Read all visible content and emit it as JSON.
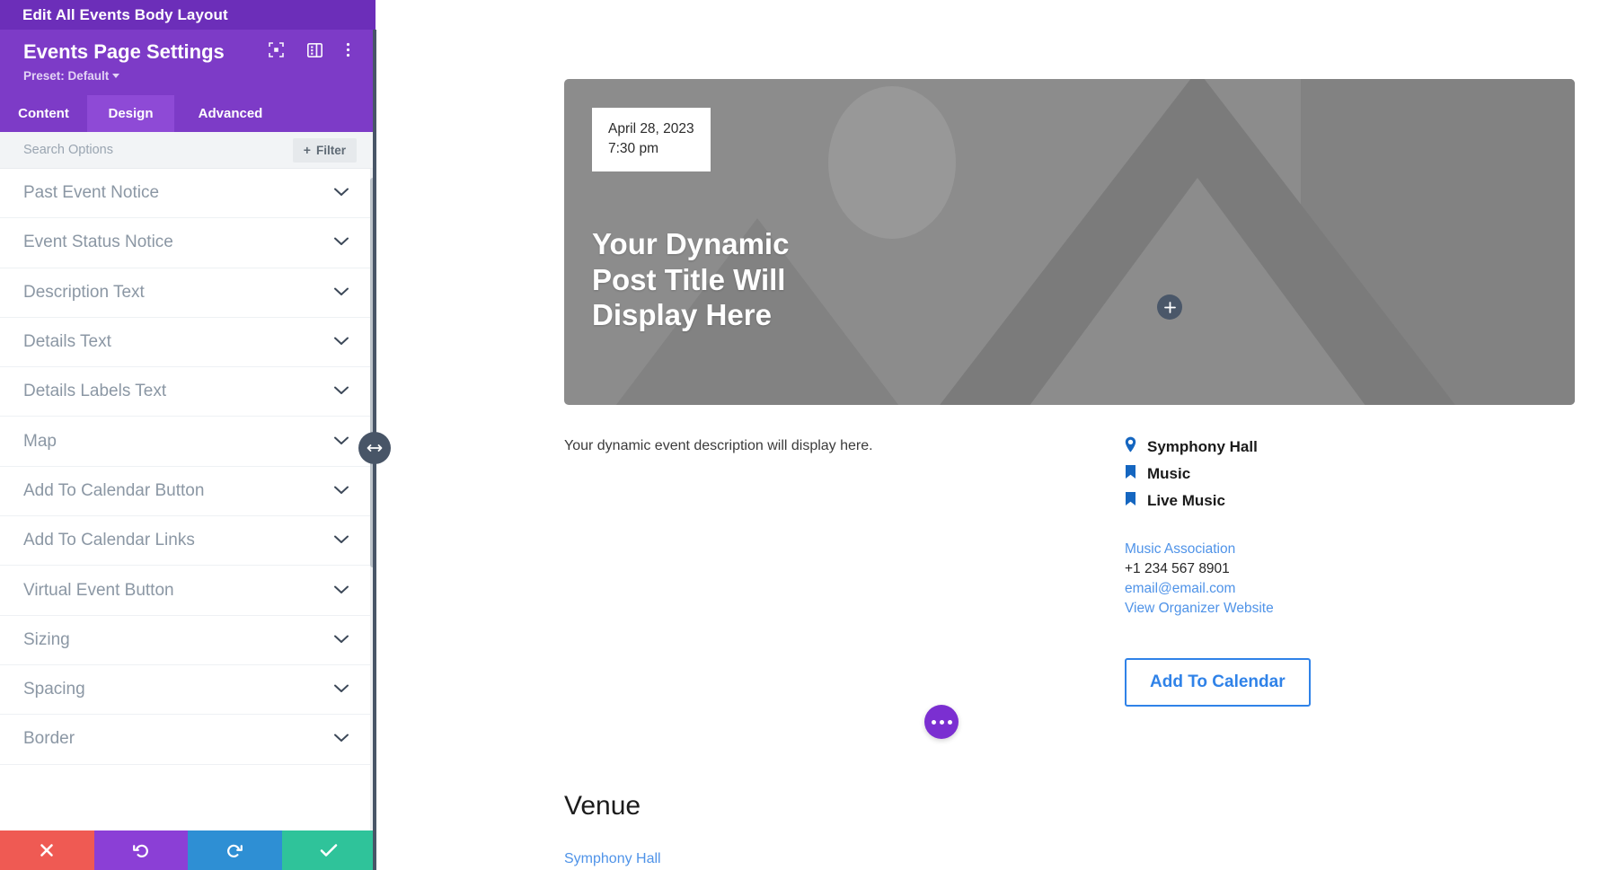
{
  "panel": {
    "topbar_title": "Edit All Events Body Layout",
    "title": "Events Page Settings",
    "preset_label": "Preset: Default",
    "header_icons": [
      {
        "name": "focus-target-icon"
      },
      {
        "name": "layout-panel-icon"
      },
      {
        "name": "more-vertical-icon"
      }
    ],
    "tabs": [
      {
        "label": "Content",
        "active": false
      },
      {
        "label": "Design",
        "active": true
      },
      {
        "label": "Advanced",
        "active": false
      }
    ],
    "search": {
      "placeholder": "Search Options",
      "value": "",
      "filter_label": "Filter",
      "filter_plus": "+"
    },
    "options": [
      {
        "label": "Past Event Notice"
      },
      {
        "label": "Event Status Notice"
      },
      {
        "label": "Description Text"
      },
      {
        "label": "Details Text"
      },
      {
        "label": "Details Labels Text"
      },
      {
        "label": "Map"
      },
      {
        "label": "Add To Calendar Button"
      },
      {
        "label": "Add To Calendar Links"
      },
      {
        "label": "Virtual Event Button"
      },
      {
        "label": "Sizing"
      },
      {
        "label": "Spacing"
      },
      {
        "label": "Border"
      }
    ],
    "bottom_actions": [
      {
        "name": "cancel-button",
        "icon": "close-icon",
        "color": "#ef5a53"
      },
      {
        "name": "undo-button",
        "icon": "undo-icon",
        "color": "#8b3fd6"
      },
      {
        "name": "redo-button",
        "icon": "redo-icon",
        "color": "#2e8fd4"
      },
      {
        "name": "save-button",
        "icon": "check-icon",
        "color": "#2fc39a"
      }
    ]
  },
  "preview": {
    "hero": {
      "date": "April 28, 2023",
      "time": "7:30 pm",
      "title": "Your Dynamic Post Title Will Display Here",
      "add_module_label": "+"
    },
    "description": "Your dynamic event description will display here.",
    "details": [
      {
        "icon": "location-pin-icon",
        "text": "Symphony Hall"
      },
      {
        "icon": "bookmark-icon",
        "text": "Music"
      },
      {
        "icon": "bookmark-icon",
        "text": "Live Music"
      }
    ],
    "organizer": {
      "name": "Music Association",
      "phone": "+1 234 567 8901",
      "email": "email@email.com",
      "website_label": "View Organizer Website"
    },
    "add_to_calendar_label": "Add To Calendar",
    "venue": {
      "heading": "Venue",
      "link": "Symphony Hall"
    }
  },
  "colors": {
    "brand_purple": "#7d3bc7",
    "topbar_purple": "#6c2eb9",
    "active_tab": "#8e4ad6",
    "link_blue": "#4f93e8",
    "button_blue": "#2f82e8",
    "detail_icon_blue": "#1566c0",
    "fab_purple": "#7b2fd1"
  }
}
